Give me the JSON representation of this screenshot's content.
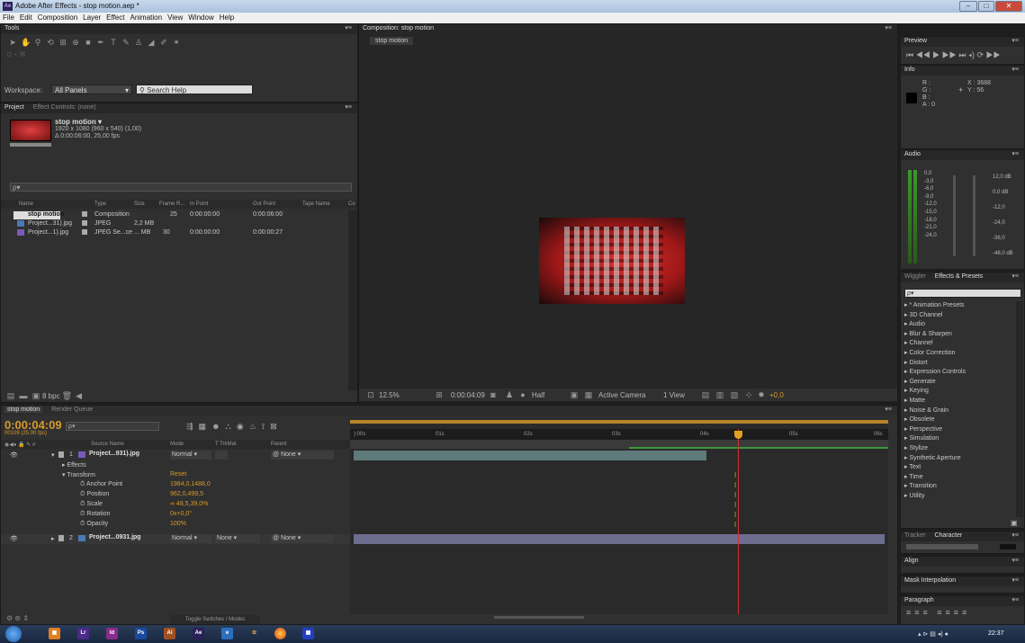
{
  "window": {
    "title": "Adobe After Effects - stop motion.aep *",
    "app_icon": "Ae"
  },
  "menu": [
    "File",
    "Edit",
    "Composition",
    "Layer",
    "Effect",
    "Animation",
    "View",
    "Window",
    "Help"
  ],
  "tools": {
    "tab": "Tools",
    "workspace_label": "Workspace:",
    "workspace_value": "All Panels",
    "search_help": "Search Help"
  },
  "project": {
    "tabs": [
      "Project",
      "Effect Controls: (none)"
    ],
    "comp_name": "stop motion ▾",
    "comp_info1": "1920 x 1080  (960 x 540) (1,00)",
    "comp_info2": "Δ 0:00:06:00, 25,00 fps",
    "search_placeholder": "ρ▾",
    "columns": [
      "Name",
      "Type",
      "Size",
      "Frame R...",
      "In Point",
      "Out Point",
      "Tape Name",
      "Co"
    ],
    "rows": [
      {
        "name": "stop motion",
        "type": "Composition",
        "size": "",
        "fps": "25",
        "in": "0:00:00:00",
        "out": "0:00:06:00"
      },
      {
        "name": "Project...31).jpg",
        "type": "JPEG",
        "size": "2,2 MB",
        "fps": "",
        "in": "",
        "out": ""
      },
      {
        "name": "Project...1).jpg",
        "type": "JPEG Se...ce",
        "size": "... MB",
        "fps": "30",
        "in": "0:00:00:00",
        "out": "0:00:00:27"
      }
    ],
    "bpc": "8 bpc"
  },
  "composition": {
    "tab": "Composition: stop motion",
    "subtab": "stop motion",
    "zoom": "12.5%",
    "timecode": "0:00:04:09",
    "resolution": "Half",
    "camera": "Active Camera",
    "view": "1 View",
    "exposure": "+0,0"
  },
  "preview": {
    "tab": "Preview"
  },
  "info": {
    "tab": "Info",
    "r": "R :",
    "g": "G :",
    "b": "B :",
    "a": "A : 0",
    "x": "X : 3688",
    "y": "Y : 56"
  },
  "audio": {
    "tab": "Audio",
    "left_scale": [
      "0,0",
      "-3,0",
      "-6,0",
      "-9,0",
      "-12,0",
      "-15,0",
      "-18,0",
      "-21,0",
      "-24,0"
    ],
    "right_scale": [
      "12,0 dB",
      "0,0 dB",
      "-12,0",
      "-24,0",
      "-36,0",
      "-48,0 dB"
    ]
  },
  "effects": {
    "tabs": [
      "Wiggler",
      "Effects & Presets"
    ],
    "items": [
      "* Animation Presets",
      "3D Channel",
      "Audio",
      "Blur & Sharpen",
      "Channel",
      "Color Correction",
      "Distort",
      "Expression Controls",
      "Generate",
      "Keying",
      "Matte",
      "Noise & Grain",
      "Obsolete",
      "Perspective",
      "Simulation",
      "Stylize",
      "Synthetic Aperture",
      "Text",
      "Time",
      "Transition",
      "Utility"
    ]
  },
  "right_panels": {
    "tracker_tabs": [
      "Tracker",
      "Character"
    ],
    "align": "Align",
    "mask": "Mask Interpolation",
    "paragraph": "Paragraph"
  },
  "timeline": {
    "tabs": [
      "stop motion",
      "Render Queue"
    ],
    "timecode": "0:00:04:09",
    "frame_info": "00109 (25.00 fps)",
    "columns": [
      "Source Name",
      "Mode",
      "T  TrkMat",
      "Parent"
    ],
    "ruler": [
      "):00s",
      "01s",
      "02s",
      "03s",
      "04s",
      "05s",
      "06s"
    ],
    "layers": [
      {
        "num": "1",
        "name": "Project...931).jpg",
        "mode": "Normal",
        "trkmat": "",
        "parent": "None"
      },
      {
        "num": "2",
        "name": "Project...0931.jpg",
        "mode": "Normal",
        "trkmat": "None",
        "parent": "None"
      }
    ],
    "props": [
      {
        "label": "Effects",
        "value": ""
      },
      {
        "label": "Transform",
        "value": "Reset"
      },
      {
        "label": "Anchor Point",
        "value": "1984,0,1488,0"
      },
      {
        "label": "Position",
        "value": "962,0,499,5"
      },
      {
        "label": "Scale",
        "value": "∞ 48,5,39,0%"
      },
      {
        "label": "Rotation",
        "value": "0x+0,0°"
      },
      {
        "label": "Opacity",
        "value": "100%"
      }
    ],
    "toggle": "Toggle Switches / Modes"
  },
  "taskbar": {
    "time": "22:37"
  },
  "colors": {
    "accent_orange": "#d69a2c",
    "timeline_bar": "#5f7a7a",
    "cti_red": "#d03030"
  }
}
